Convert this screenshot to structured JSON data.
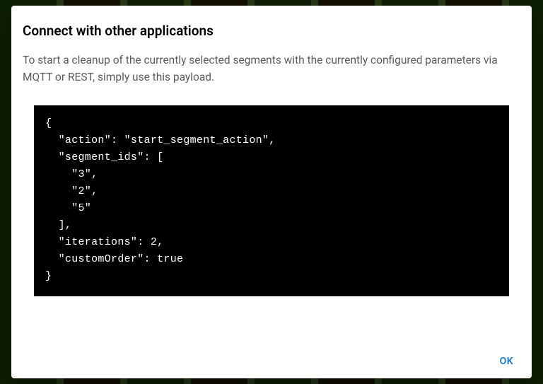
{
  "dialog": {
    "title": "Connect with other applications",
    "description": "To start a cleanup of the currently selected segments with the currently configured parameters via MQTT or REST, simply use this payload.",
    "payload_text": "{\n  \"action\": \"start_segment_action\",\n  \"segment_ids\": [\n    \"3\",\n    \"2\",\n    \"5\"\n  ],\n  \"iterations\": 2,\n  \"customOrder\": true\n}",
    "payload": {
      "action": "start_segment_action",
      "segment_ids": [
        "3",
        "2",
        "5"
      ],
      "iterations": 2,
      "customOrder": true
    },
    "ok_label": "OK"
  }
}
